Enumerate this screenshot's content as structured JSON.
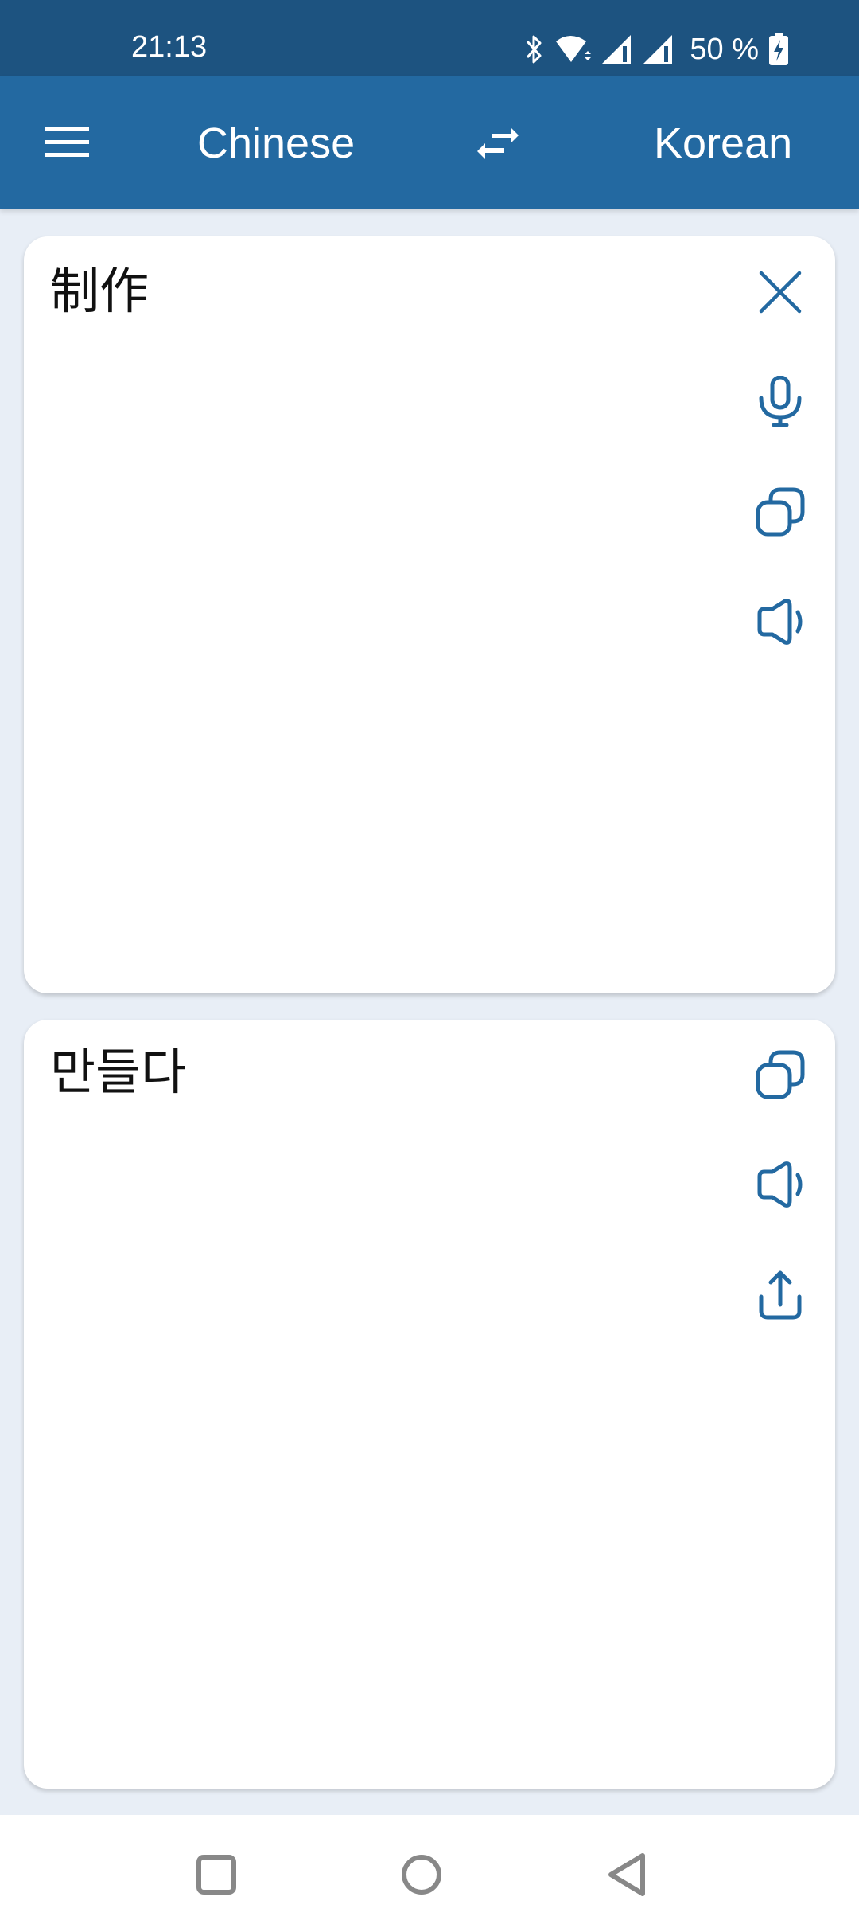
{
  "status_bar": {
    "time": "21:13",
    "battery_text": "50 %",
    "icons": [
      "bluetooth-icon",
      "wifi-icon",
      "signal-icon",
      "signal-icon",
      "battery-charging-icon"
    ]
  },
  "app_bar": {
    "menu_icon": "hamburger-menu-icon",
    "source_language": "Chinese",
    "swap_icon": "swap-languages-icon",
    "target_language": "Korean"
  },
  "source_card": {
    "text": "制作",
    "actions": [
      "clear-icon",
      "microphone-icon",
      "copy-icon",
      "speaker-icon"
    ]
  },
  "target_card": {
    "text": "만들다",
    "actions": [
      "copy-icon",
      "speaker-icon",
      "share-icon"
    ]
  },
  "nav_bar": {
    "buttons": [
      "recents-button",
      "home-button",
      "back-button"
    ]
  },
  "colors": {
    "status_bar": "#1d5380",
    "app_bar": "#2369a1",
    "accent_icon": "#2369a1",
    "background": "#e8eef6",
    "card": "#ffffff"
  }
}
